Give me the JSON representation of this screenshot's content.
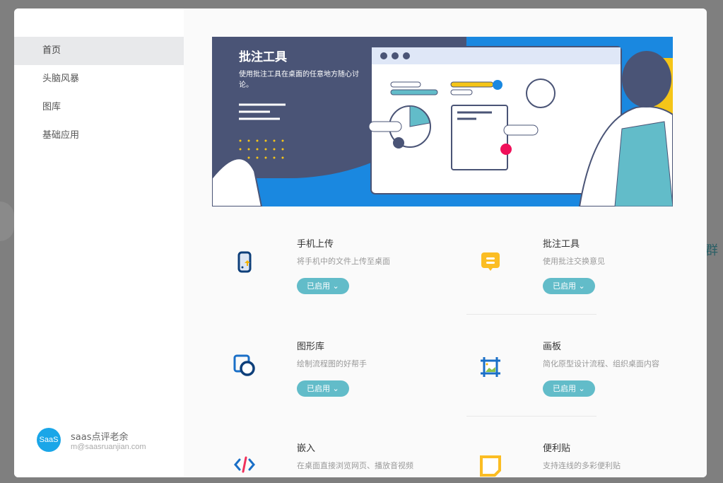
{
  "sidebar": {
    "items": [
      {
        "label": "首页"
      },
      {
        "label": "头脑风暴"
      },
      {
        "label": "图库"
      },
      {
        "label": "基础应用"
      }
    ]
  },
  "user": {
    "logo": "SaaS",
    "name": "saas点评老余",
    "email": "m@saasruanjian.com"
  },
  "banner": {
    "title": "批注工具",
    "subtitle": "使用批注工具在桌面的任意地方随心讨论。"
  },
  "background": {
    "text": "群"
  },
  "apps": [
    {
      "title": "手机上传",
      "desc": "将手机中的文件上传至桌面",
      "status": "已启用",
      "icon": "phone-upload-icon"
    },
    {
      "title": "批注工具",
      "desc": "使用批注交换意见",
      "status": "已启用",
      "icon": "comment-icon"
    },
    {
      "title": "图形库",
      "desc": "绘制流程图的好帮手",
      "status": "已启用",
      "icon": "shapes-icon"
    },
    {
      "title": "画板",
      "desc": "简化原型设计流程、组织桌面内容",
      "status": "已启用",
      "icon": "artboard-icon"
    },
    {
      "title": "嵌入",
      "desc": "在桌面直接浏览网页、播放音视频",
      "icon": "embed-code-icon"
    },
    {
      "title": "便利贴",
      "desc": "支持连线的多彩便利贴",
      "icon": "sticky-note-icon"
    }
  ],
  "colors": {
    "accent": "#62bcc9",
    "banner_blue": "#1a88e0",
    "banner_dark": "#4a5476"
  }
}
